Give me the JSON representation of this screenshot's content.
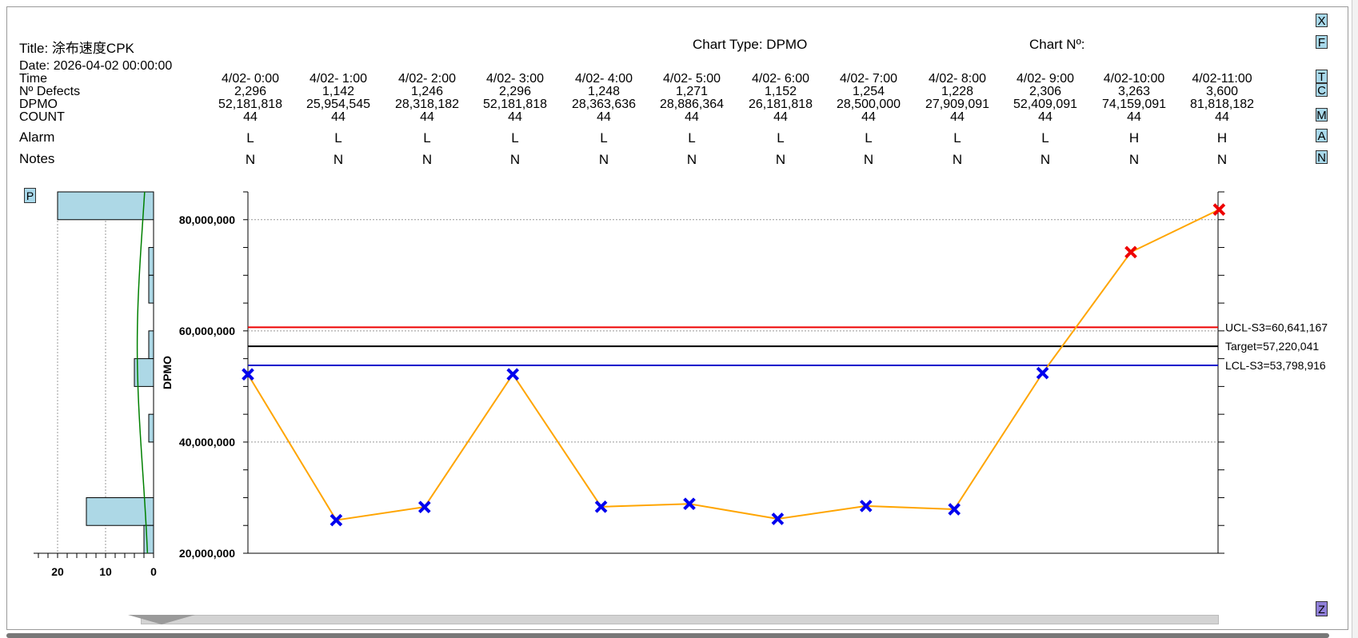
{
  "header": {
    "title": "Title: 涂布速度CPK",
    "chart_type": "Chart Type: DPMO",
    "chart_no": "Chart Nº:",
    "date": "Date: 2026-04-02 00:00:00"
  },
  "row_labels": {
    "time": "Time",
    "defects": "Nº Defects",
    "dpmo": "DPMO",
    "count": "COUNT",
    "alarm": "Alarm",
    "notes": "Notes"
  },
  "columns": [
    {
      "time": "4/02- 0:00",
      "defects": "2,296",
      "dpmo": "52,181,818",
      "count": "44",
      "alarm": "L",
      "notes": "N"
    },
    {
      "time": "4/02- 1:00",
      "defects": "1,142",
      "dpmo": "25,954,545",
      "count": "44",
      "alarm": "L",
      "notes": "N"
    },
    {
      "time": "4/02- 2:00",
      "defects": "1,246",
      "dpmo": "28,318,182",
      "count": "44",
      "alarm": "L",
      "notes": "N"
    },
    {
      "time": "4/02- 3:00",
      "defects": "2,296",
      "dpmo": "52,181,818",
      "count": "44",
      "alarm": "L",
      "notes": "N"
    },
    {
      "time": "4/02- 4:00",
      "defects": "1,248",
      "dpmo": "28,363,636",
      "count": "44",
      "alarm": "L",
      "notes": "N"
    },
    {
      "time": "4/02- 5:00",
      "defects": "1,271",
      "dpmo": "28,886,364",
      "count": "44",
      "alarm": "L",
      "notes": "N"
    },
    {
      "time": "4/02- 6:00",
      "defects": "1,152",
      "dpmo": "26,181,818",
      "count": "44",
      "alarm": "L",
      "notes": "N"
    },
    {
      "time": "4/02- 7:00",
      "defects": "1,254",
      "dpmo": "28,500,000",
      "count": "44",
      "alarm": "L",
      "notes": "N"
    },
    {
      "time": "4/02- 8:00",
      "defects": "1,228",
      "dpmo": "27,909,091",
      "count": "44",
      "alarm": "L",
      "notes": "N"
    },
    {
      "time": "4/02- 9:00",
      "defects": "2,306",
      "dpmo": "52,409,091",
      "count": "44",
      "alarm": "L",
      "notes": "N"
    },
    {
      "time": "4/02-10:00",
      "defects": "3,263",
      "dpmo": "74,159,091",
      "count": "44",
      "alarm": "H",
      "notes": "N"
    },
    {
      "time": "4/02-11:00",
      "defects": "3,600",
      "dpmo": "81,818,182",
      "count": "44",
      "alarm": "H",
      "notes": "N"
    }
  ],
  "side_buttons": [
    "X",
    "F",
    "T",
    "C",
    "M",
    "A",
    "N"
  ],
  "p_button": "P",
  "z_button": "Z",
  "chart_data": {
    "type": "line",
    "ylabel": "DPMO",
    "ylim": [
      20000000,
      85000000
    ],
    "yticks": [
      20000000,
      40000000,
      60000000,
      80000000
    ],
    "ytick_labels": [
      "20,000,000",
      "40,000,000",
      "60,000,000",
      "80,000,000"
    ],
    "x": [
      "4/02- 0:00",
      "4/02- 1:00",
      "4/02- 2:00",
      "4/02- 3:00",
      "4/02- 4:00",
      "4/02- 5:00",
      "4/02- 6:00",
      "4/02- 7:00",
      "4/02- 8:00",
      "4/02- 9:00",
      "4/02-10:00",
      "4/02-11:00"
    ],
    "values": [
      52181818,
      25954545,
      28318182,
      52181818,
      28363636,
      28886364,
      26181818,
      28500000,
      27909091,
      52409091,
      74159091,
      81818182
    ],
    "point_colors": [
      "#0000ee",
      "#0000ee",
      "#0000ee",
      "#0000ee",
      "#0000ee",
      "#0000ee",
      "#0000ee",
      "#0000ee",
      "#0000ee",
      "#0000ee",
      "#ee0000",
      "#ee0000"
    ],
    "line_color": "#ffa500",
    "control_lines": [
      {
        "label": "UCL-S3=60,641,167",
        "value": 60641167,
        "color": "#ee0000"
      },
      {
        "label": "Target=57,220,041",
        "value": 57220041,
        "color": "#000000"
      },
      {
        "label": "LCL-S3=53,798,916",
        "value": 53798916,
        "color": "#0000cc"
      }
    ],
    "grid": "dotted at 40,000,000 and 80,000,000",
    "histogram": {
      "orientation": "horizontal",
      "xlim": [
        0,
        25
      ],
      "xtick_labels": [
        "20",
        "10",
        "0"
      ],
      "xticks": [
        20,
        10,
        0
      ],
      "bins": [
        {
          "from": 80000000,
          "to": 85000000,
          "count": 20
        },
        {
          "from": 70000000,
          "to": 75000000,
          "count": 1
        },
        {
          "from": 65000000,
          "to": 70000000,
          "count": 1
        },
        {
          "from": 55000000,
          "to": 60000000,
          "count": 1
        },
        {
          "from": 50000000,
          "to": 55000000,
          "count": 4
        },
        {
          "from": 40000000,
          "to": 45000000,
          "count": 1
        },
        {
          "from": 25000000,
          "to": 30000000,
          "count": 14
        },
        {
          "from": 20000000,
          "to": 25000000,
          "count": 2
        }
      ],
      "curve_color": "#008000"
    }
  }
}
